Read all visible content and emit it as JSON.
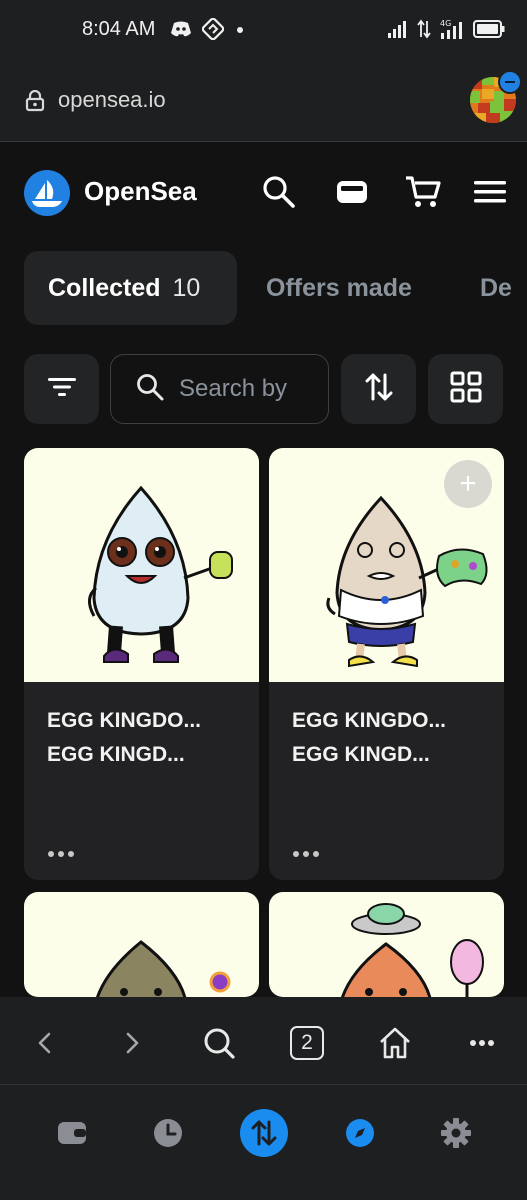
{
  "status_bar": {
    "time": "8:04 AM",
    "network": "4G"
  },
  "browser": {
    "url": "opensea.io",
    "tab_count": "2"
  },
  "header": {
    "brand": "OpenSea"
  },
  "tabs": [
    {
      "label": "Collected",
      "count": "10",
      "active": true
    },
    {
      "label": "Offers made",
      "active": false
    },
    {
      "label": "De",
      "active": false
    }
  ],
  "filters": {
    "search_placeholder": "Search by"
  },
  "cards": [
    {
      "line1": "EGG KINGDO...",
      "line2": "EGG KINGD...",
      "more": "•••"
    },
    {
      "line1": "EGG KINGDO...",
      "line2": "EGG KINGD...",
      "more": "•••",
      "add_label": "+"
    },
    {
      "line1": "",
      "line2": ""
    },
    {
      "line1": "",
      "line2": ""
    }
  ],
  "colors": {
    "background": "#121212",
    "surface": "#232426",
    "accent": "#2081e2",
    "card_image_bg": "#fdfeea",
    "app_nav_accent": "#1a8cf0"
  },
  "icons": {
    "status_left": [
      "discord-icon",
      "app-icon",
      "dot-icon"
    ],
    "status_right": [
      "signal-icon",
      "data-arrows-icon",
      "signal-4g-icon",
      "battery-icon"
    ],
    "header": [
      "search-icon",
      "wallet-icon",
      "cart-icon",
      "menu-icon"
    ],
    "filter_row": [
      "filter-icon",
      "search-icon",
      "sort-icon",
      "grid-icon"
    ],
    "browser_nav": [
      "back-icon",
      "forward-icon",
      "search-icon",
      "tabs-icon",
      "home-icon",
      "more-icon"
    ],
    "app_nav": [
      "wallet-icon",
      "history-icon",
      "swap-icon",
      "explore-icon",
      "settings-icon"
    ]
  }
}
